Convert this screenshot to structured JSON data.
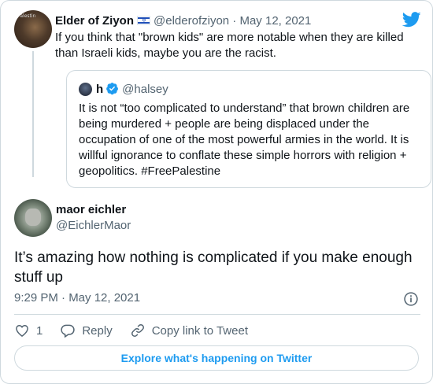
{
  "colors": {
    "accent": "#1d9bf0",
    "text": "#0f1419",
    "muted": "#536471",
    "border": "#cfd9de"
  },
  "parent_tweet": {
    "avatar_label": "Palestin",
    "display_name": "Elder of Ziyon",
    "flag_icon": "israel-flag-icon",
    "handle": "@elderofziyon",
    "separator": "·",
    "date": "May 12, 2021",
    "text": "If you think that \"brown kids\" are more notable when they are killed than Israeli kids, maybe you are the racist."
  },
  "quoted_tweet": {
    "display_name": "h",
    "verified_icon": "verified-badge-icon",
    "handle": "@halsey",
    "text": "It is not “too complicated to understand” that brown children are being murdered + people are being displaced under the occupation of one of the most powerful armies in the world. It is willful ignorance to conflate these simple horrors with religion + geopolitics. #FreePalestine"
  },
  "main_tweet": {
    "display_name": "maor eichler",
    "handle": "@EichlerMaor",
    "text": "It’s amazing how nothing is complicated if you make enough stuff up",
    "timestamp": "9:29 PM · May 12, 2021"
  },
  "actions": {
    "like_count": "1",
    "reply_label": "Reply",
    "copy_link_label": "Copy link to Tweet"
  },
  "explore_label": "Explore what's happening on Twitter"
}
